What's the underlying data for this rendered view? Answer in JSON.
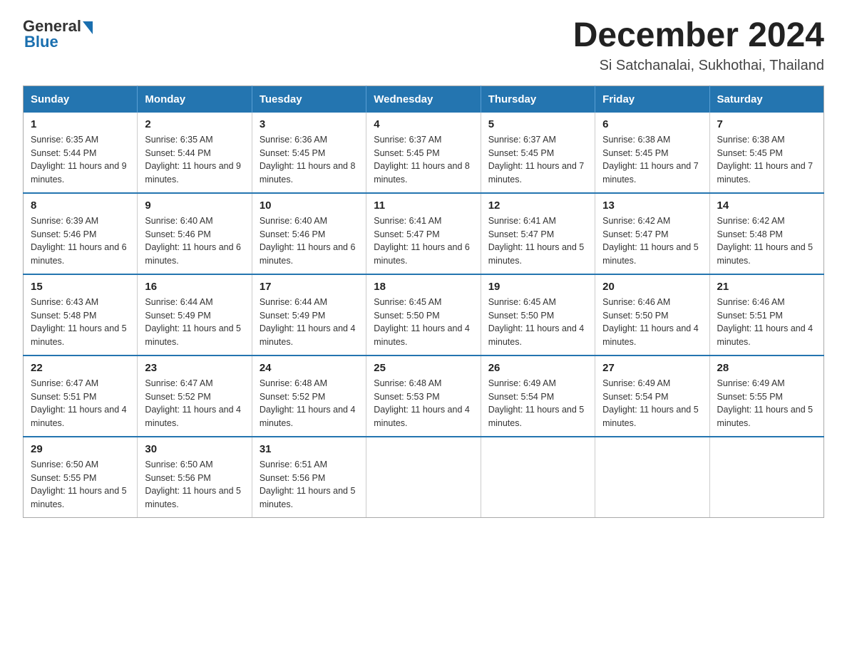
{
  "logo": {
    "text_general": "General",
    "text_blue": "Blue"
  },
  "title": "December 2024",
  "subtitle": "Si Satchanalai, Sukhothai, Thailand",
  "days_of_week": [
    "Sunday",
    "Monday",
    "Tuesday",
    "Wednesday",
    "Thursday",
    "Friday",
    "Saturday"
  ],
  "weeks": [
    [
      {
        "day": "1",
        "sunrise": "6:35 AM",
        "sunset": "5:44 PM",
        "daylight": "11 hours and 9 minutes."
      },
      {
        "day": "2",
        "sunrise": "6:35 AM",
        "sunset": "5:44 PM",
        "daylight": "11 hours and 9 minutes."
      },
      {
        "day": "3",
        "sunrise": "6:36 AM",
        "sunset": "5:45 PM",
        "daylight": "11 hours and 8 minutes."
      },
      {
        "day": "4",
        "sunrise": "6:37 AM",
        "sunset": "5:45 PM",
        "daylight": "11 hours and 8 minutes."
      },
      {
        "day": "5",
        "sunrise": "6:37 AM",
        "sunset": "5:45 PM",
        "daylight": "11 hours and 7 minutes."
      },
      {
        "day": "6",
        "sunrise": "6:38 AM",
        "sunset": "5:45 PM",
        "daylight": "11 hours and 7 minutes."
      },
      {
        "day": "7",
        "sunrise": "6:38 AM",
        "sunset": "5:45 PM",
        "daylight": "11 hours and 7 minutes."
      }
    ],
    [
      {
        "day": "8",
        "sunrise": "6:39 AM",
        "sunset": "5:46 PM",
        "daylight": "11 hours and 6 minutes."
      },
      {
        "day": "9",
        "sunrise": "6:40 AM",
        "sunset": "5:46 PM",
        "daylight": "11 hours and 6 minutes."
      },
      {
        "day": "10",
        "sunrise": "6:40 AM",
        "sunset": "5:46 PM",
        "daylight": "11 hours and 6 minutes."
      },
      {
        "day": "11",
        "sunrise": "6:41 AM",
        "sunset": "5:47 PM",
        "daylight": "11 hours and 6 minutes."
      },
      {
        "day": "12",
        "sunrise": "6:41 AM",
        "sunset": "5:47 PM",
        "daylight": "11 hours and 5 minutes."
      },
      {
        "day": "13",
        "sunrise": "6:42 AM",
        "sunset": "5:47 PM",
        "daylight": "11 hours and 5 minutes."
      },
      {
        "day": "14",
        "sunrise": "6:42 AM",
        "sunset": "5:48 PM",
        "daylight": "11 hours and 5 minutes."
      }
    ],
    [
      {
        "day": "15",
        "sunrise": "6:43 AM",
        "sunset": "5:48 PM",
        "daylight": "11 hours and 5 minutes."
      },
      {
        "day": "16",
        "sunrise": "6:44 AM",
        "sunset": "5:49 PM",
        "daylight": "11 hours and 5 minutes."
      },
      {
        "day": "17",
        "sunrise": "6:44 AM",
        "sunset": "5:49 PM",
        "daylight": "11 hours and 4 minutes."
      },
      {
        "day": "18",
        "sunrise": "6:45 AM",
        "sunset": "5:50 PM",
        "daylight": "11 hours and 4 minutes."
      },
      {
        "day": "19",
        "sunrise": "6:45 AM",
        "sunset": "5:50 PM",
        "daylight": "11 hours and 4 minutes."
      },
      {
        "day": "20",
        "sunrise": "6:46 AM",
        "sunset": "5:50 PM",
        "daylight": "11 hours and 4 minutes."
      },
      {
        "day": "21",
        "sunrise": "6:46 AM",
        "sunset": "5:51 PM",
        "daylight": "11 hours and 4 minutes."
      }
    ],
    [
      {
        "day": "22",
        "sunrise": "6:47 AM",
        "sunset": "5:51 PM",
        "daylight": "11 hours and 4 minutes."
      },
      {
        "day": "23",
        "sunrise": "6:47 AM",
        "sunset": "5:52 PM",
        "daylight": "11 hours and 4 minutes."
      },
      {
        "day": "24",
        "sunrise": "6:48 AM",
        "sunset": "5:52 PM",
        "daylight": "11 hours and 4 minutes."
      },
      {
        "day": "25",
        "sunrise": "6:48 AM",
        "sunset": "5:53 PM",
        "daylight": "11 hours and 4 minutes."
      },
      {
        "day": "26",
        "sunrise": "6:49 AM",
        "sunset": "5:54 PM",
        "daylight": "11 hours and 5 minutes."
      },
      {
        "day": "27",
        "sunrise": "6:49 AM",
        "sunset": "5:54 PM",
        "daylight": "11 hours and 5 minutes."
      },
      {
        "day": "28",
        "sunrise": "6:49 AM",
        "sunset": "5:55 PM",
        "daylight": "11 hours and 5 minutes."
      }
    ],
    [
      {
        "day": "29",
        "sunrise": "6:50 AM",
        "sunset": "5:55 PM",
        "daylight": "11 hours and 5 minutes."
      },
      {
        "day": "30",
        "sunrise": "6:50 AM",
        "sunset": "5:56 PM",
        "daylight": "11 hours and 5 minutes."
      },
      {
        "day": "31",
        "sunrise": "6:51 AM",
        "sunset": "5:56 PM",
        "daylight": "11 hours and 5 minutes."
      },
      null,
      null,
      null,
      null
    ]
  ]
}
